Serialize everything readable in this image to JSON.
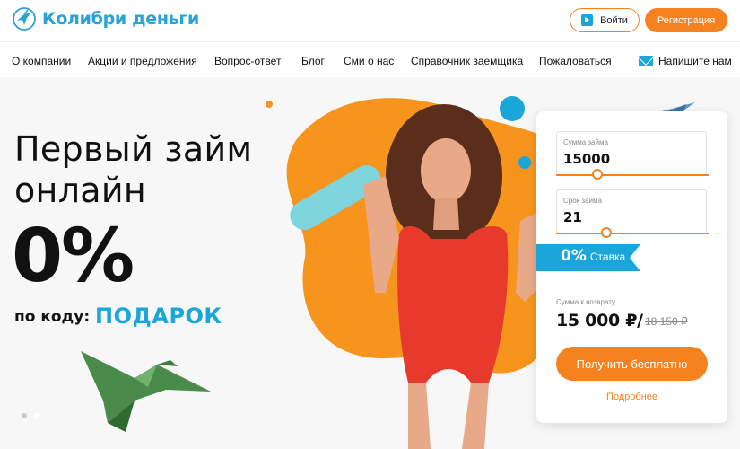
{
  "header": {
    "logo_text": "Колибри деньги",
    "logo_icon": "hummingbird-logo-icon",
    "login_label": "Войти",
    "login_icon": "login-arrow-icon",
    "register_label": "Регистрация"
  },
  "nav": {
    "items": [
      {
        "label": "О компании"
      },
      {
        "label": "Акции и предложения"
      },
      {
        "label": "Вопрос-ответ"
      },
      {
        "label": "Блог"
      },
      {
        "label": "Сми о нас"
      },
      {
        "label": "Справочник заемщика"
      },
      {
        "label": "Пожаловаться"
      }
    ],
    "contact_label": "Напишите нам",
    "contact_icon": "mail-icon"
  },
  "hero": {
    "title_line1": "Первый займ",
    "title_line2": "онлайн",
    "percent": "0%",
    "promo_label": "по коду:",
    "promo_code": "ПОДАРОК",
    "slides_total": 2,
    "slide_active": 2
  },
  "loan_card": {
    "amount_label": "Сумма займа",
    "amount_value": "15000",
    "amount_slider_fraction": 0.27,
    "term_label": "Срок займа",
    "term_value": "21",
    "term_slider_fraction": 0.33,
    "rate_value": "0%",
    "rate_label": "Ставка",
    "repay_label": "Сумма к возврату",
    "repay_value": "15 000 ₽/",
    "repay_old_value": "18 150 ₽",
    "submit_label": "Получить бесплатно",
    "more_label": "Подробнее"
  },
  "colors": {
    "accent_orange": "#f5821f",
    "accent_blue": "#1aa6d9",
    "origami_green": "#5a9a5a"
  }
}
